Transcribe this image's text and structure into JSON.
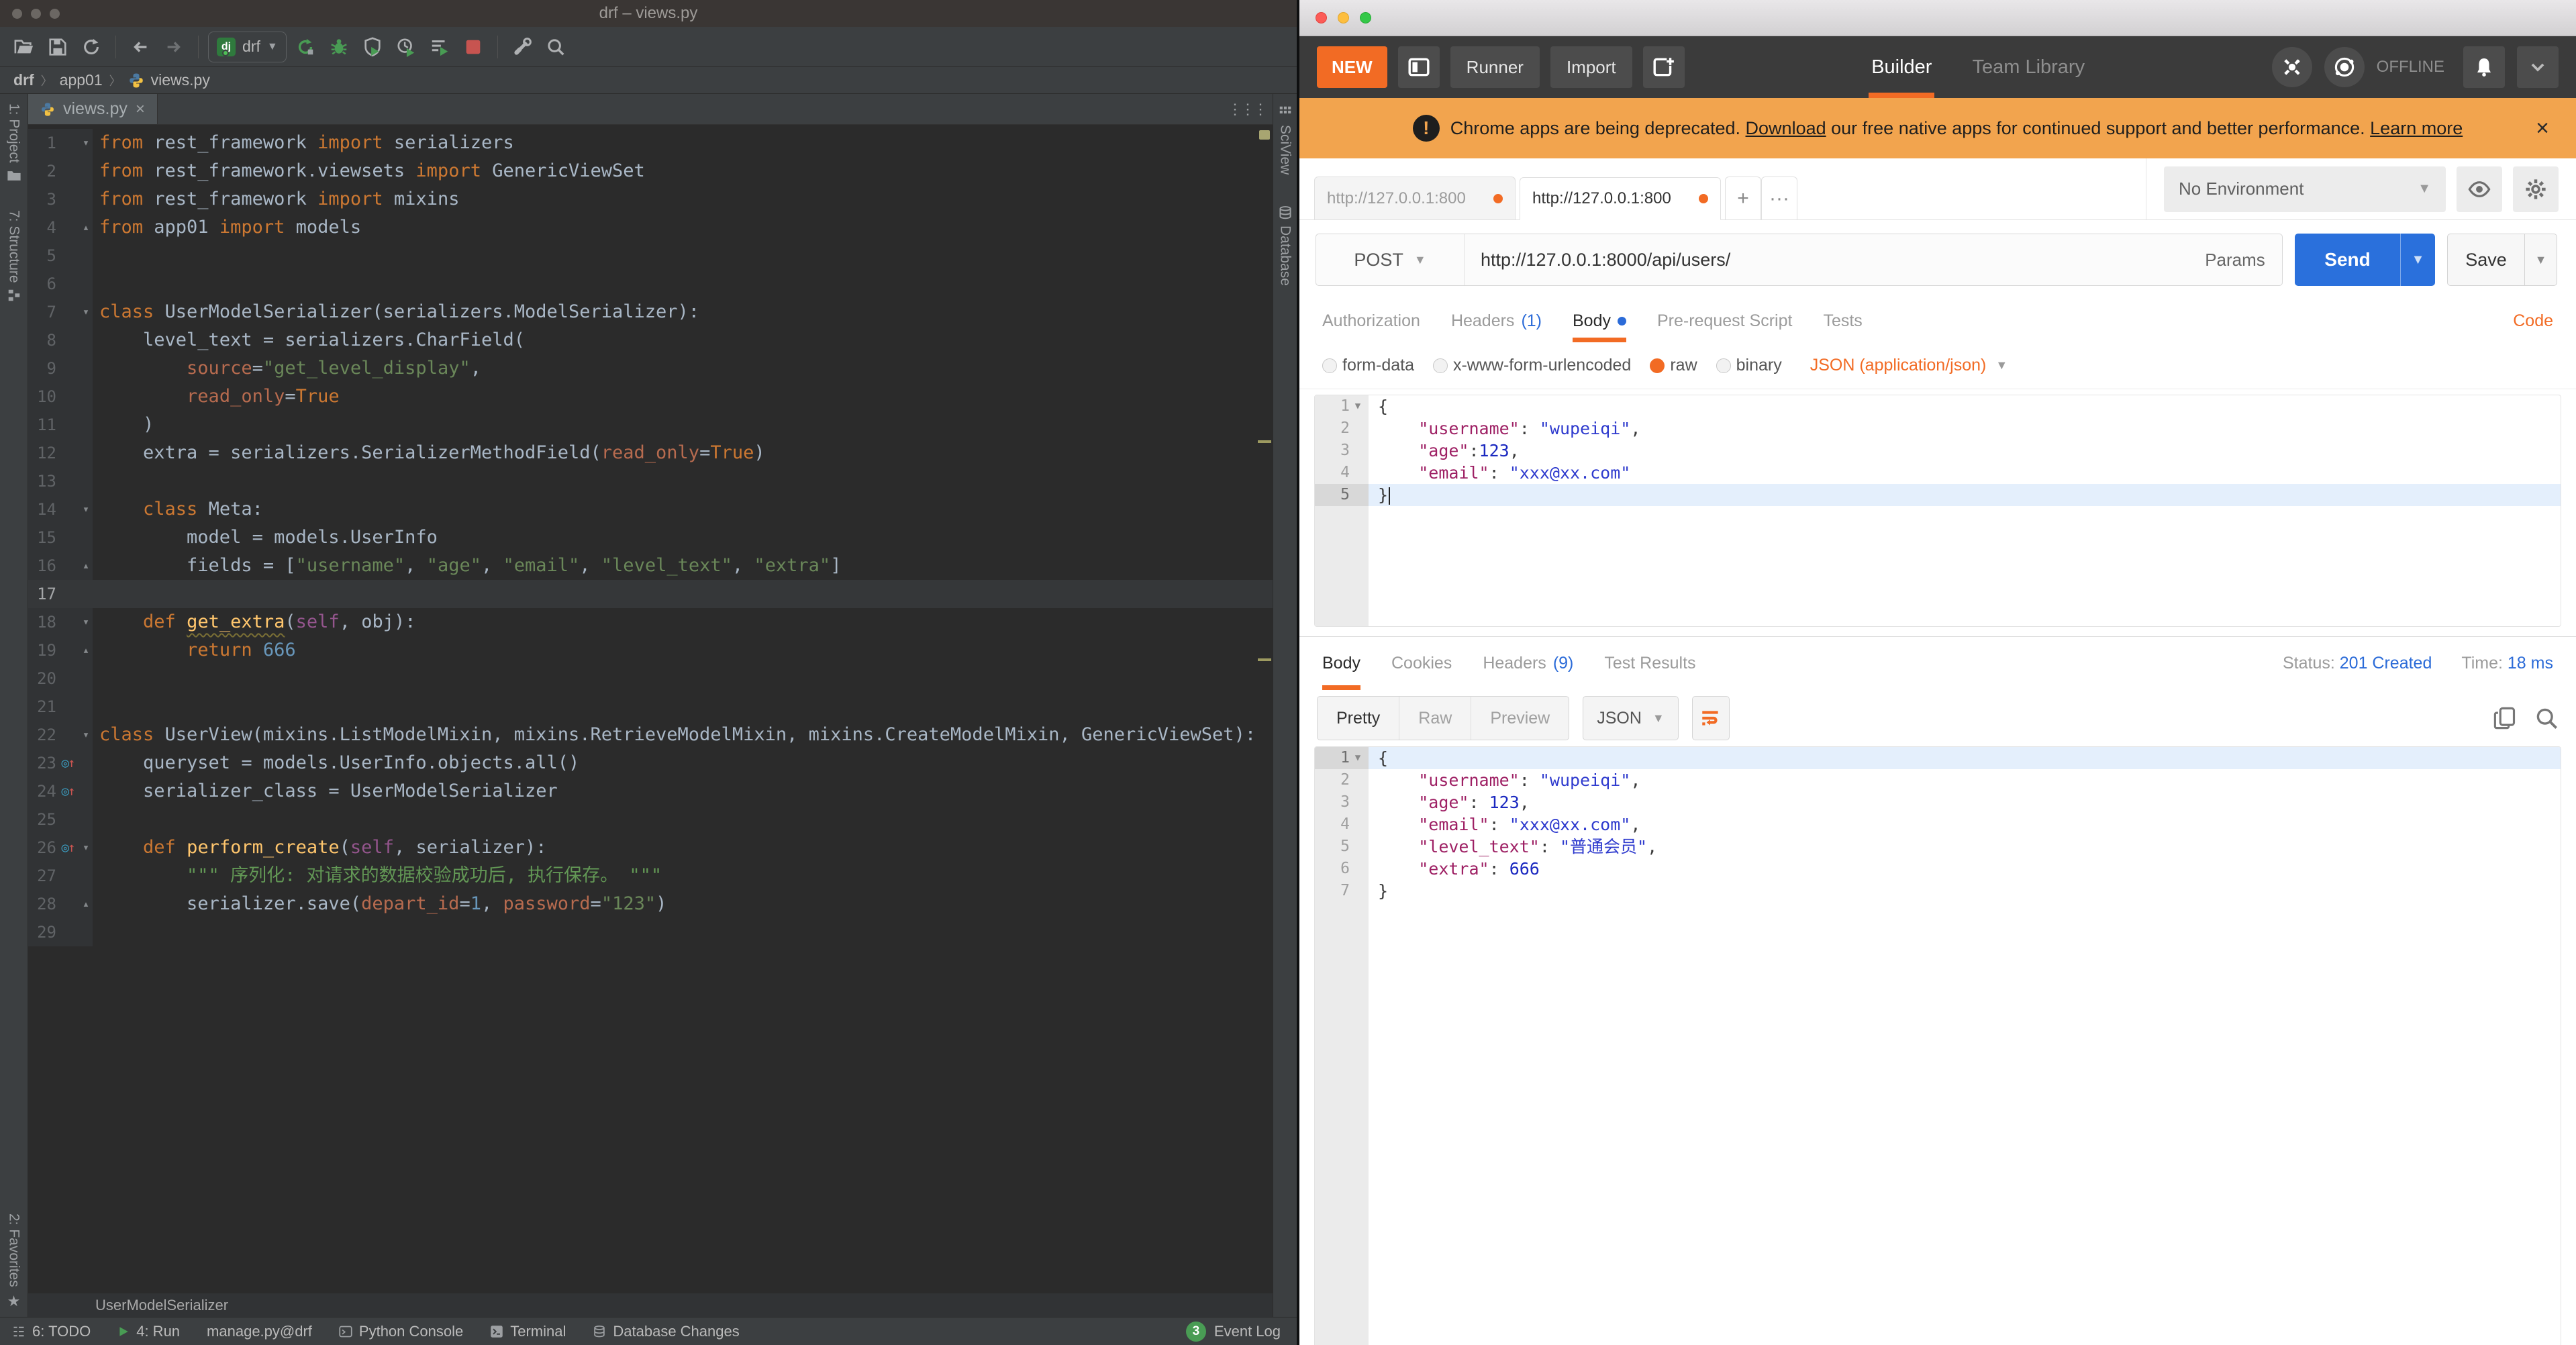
{
  "pycharm": {
    "title": "drf – views.py",
    "toolbar": {
      "run_config": "drf"
    },
    "breadcrumbs": [
      "drf",
      "app01",
      "views.py"
    ],
    "tab": "views.py",
    "stripes": {
      "left": [
        "1: Project",
        "7: Structure"
      ],
      "left_bottom": "2: Favorites",
      "right": [
        "SciView",
        "Database"
      ]
    },
    "bottom_breadcrumb": "UserModelSerializer",
    "status": {
      "items": [
        "6: TODO",
        "4: Run",
        "manage.py@drf",
        "Python Console",
        "Terminal",
        "Database Changes"
      ],
      "event_log": "Event Log",
      "event_badge": "3"
    },
    "editor": {
      "lines": [
        {
          "n": 1,
          "fold": "o",
          "t": [
            [
              "kw",
              "from"
            ],
            [
              "tx",
              " rest_framework "
            ],
            [
              "kw",
              "import"
            ],
            [
              "tx",
              " serializers"
            ]
          ]
        },
        {
          "n": 2,
          "t": [
            [
              "kw",
              "from"
            ],
            [
              "tx",
              " rest_framework.viewsets "
            ],
            [
              "kw",
              "import"
            ],
            [
              "tx",
              " GenericViewSet"
            ]
          ]
        },
        {
          "n": 3,
          "t": [
            [
              "kw",
              "from"
            ],
            [
              "tx",
              " rest_framework "
            ],
            [
              "kw",
              "import"
            ],
            [
              "tx",
              " mixins"
            ]
          ]
        },
        {
          "n": 4,
          "fold": "c",
          "t": [
            [
              "kw",
              "from"
            ],
            [
              "tx",
              " app01 "
            ],
            [
              "kw",
              "import"
            ],
            [
              "tx",
              " models"
            ]
          ]
        },
        {
          "n": 5,
          "t": []
        },
        {
          "n": 6,
          "t": []
        },
        {
          "n": 7,
          "fold": "o",
          "t": [
            [
              "kw",
              "class"
            ],
            [
              "tx",
              " UserModelSerializer(serializers.ModelSerializer):"
            ]
          ]
        },
        {
          "n": 8,
          "t": [
            [
              "tx",
              "    level_text = serializers.CharField("
            ]
          ]
        },
        {
          "n": 9,
          "t": [
            [
              "tx",
              "        "
            ],
            [
              "ar",
              "source"
            ],
            [
              "tx",
              "="
            ],
            [
              "st",
              "\"get_level_display\""
            ],
            [
              "tx",
              ","
            ]
          ]
        },
        {
          "n": 10,
          "t": [
            [
              "tx",
              "        "
            ],
            [
              "ar",
              "read_only"
            ],
            [
              "tx",
              "="
            ],
            [
              "kw",
              "True"
            ]
          ]
        },
        {
          "n": 11,
          "t": [
            [
              "tx",
              "    )"
            ]
          ]
        },
        {
          "n": 12,
          "t": [
            [
              "tx",
              "    extra = serializers.SerializerMethodField("
            ],
            [
              "ar",
              "read_only"
            ],
            [
              "tx",
              "="
            ],
            [
              "kw",
              "True"
            ],
            [
              "tx",
              ")"
            ]
          ]
        },
        {
          "n": 13,
          "t": []
        },
        {
          "n": 14,
          "fold": "o",
          "t": [
            [
              "tx",
              "    "
            ],
            [
              "kw",
              "class"
            ],
            [
              "tx",
              " Meta:"
            ]
          ]
        },
        {
          "n": 15,
          "t": [
            [
              "tx",
              "        model = models.UserInfo"
            ]
          ]
        },
        {
          "n": 16,
          "fold": "c",
          "t": [
            [
              "tx",
              "        fields = ["
            ],
            [
              "st",
              "\"username\""
            ],
            [
              "tx",
              ", "
            ],
            [
              "st",
              "\"age\""
            ],
            [
              "tx",
              ", "
            ],
            [
              "st",
              "\"email\""
            ],
            [
              "tx",
              ", "
            ],
            [
              "st",
              "\"level_text\""
            ],
            [
              "tx",
              ", "
            ],
            [
              "st",
              "\"extra\""
            ],
            [
              "tx",
              "]"
            ]
          ]
        },
        {
          "n": 17,
          "hl": true,
          "t": []
        },
        {
          "n": 18,
          "fold": "o",
          "t": [
            [
              "tx",
              "    "
            ],
            [
              "kw",
              "def"
            ],
            [
              "tx",
              " "
            ],
            [
              "fw",
              "get_extra"
            ],
            [
              "tx",
              "("
            ],
            [
              "sf",
              "self"
            ],
            [
              "tx",
              ", obj):"
            ]
          ]
        },
        {
          "n": 19,
          "fold": "c",
          "t": [
            [
              "tx",
              "        "
            ],
            [
              "kw",
              "return"
            ],
            [
              "tx",
              " "
            ],
            [
              "nm",
              "666"
            ]
          ]
        },
        {
          "n": 20,
          "t": []
        },
        {
          "n": 21,
          "t": []
        },
        {
          "n": 22,
          "fold": "o",
          "t": [
            [
              "kw",
              "class"
            ],
            [
              "tx",
              " UserView(mixins.ListModelMixin, mixins.RetrieveModelMixin, mixins.CreateModelMixin, GenericViewSet):"
            ]
          ]
        },
        {
          "n": 23,
          "ovr": true,
          "t": [
            [
              "tx",
              "    queryset = models.UserInfo.objects.all()"
            ]
          ]
        },
        {
          "n": 24,
          "ovr": true,
          "t": [
            [
              "tx",
              "    serializer_class = UserModelSerializer"
            ]
          ]
        },
        {
          "n": 25,
          "t": []
        },
        {
          "n": 26,
          "ovr": true,
          "fold": "o",
          "t": [
            [
              "tx",
              "    "
            ],
            [
              "kw",
              "def"
            ],
            [
              "tx",
              " "
            ],
            [
              "fn",
              "perform_create"
            ],
            [
              "tx",
              "("
            ],
            [
              "sf",
              "self"
            ],
            [
              "tx",
              ", serializer):"
            ]
          ]
        },
        {
          "n": 27,
          "t": [
            [
              "dc",
              "        \"\"\" 序列化: 对请求的数据校验成功后, 执行保存。 \"\"\""
            ]
          ]
        },
        {
          "n": 28,
          "fold": "c",
          "t": [
            [
              "tx",
              "        serializer.save("
            ],
            [
              "ar",
              "depart_id"
            ],
            [
              "tx",
              "="
            ],
            [
              "nm",
              "1"
            ],
            [
              "tx",
              ", "
            ],
            [
              "ar",
              "password"
            ],
            [
              "tx",
              "="
            ],
            [
              "st",
              "\"123\""
            ],
            [
              "tx",
              ")"
            ]
          ]
        },
        {
          "n": 29,
          "t": []
        }
      ]
    }
  },
  "postman": {
    "header": {
      "new_label": "NEW",
      "runner_label": "Runner",
      "import_label": "Import",
      "builder_tab": "Builder",
      "team_library_tab": "Team Library",
      "offline_label": "OFFLINE"
    },
    "banner": {
      "prefix": "Chrome apps are being deprecated.",
      "link_download": "Download",
      "middle": "our free native apps for continued support and better performance.",
      "link_learn_more": "Learn more",
      "close": "×"
    },
    "tabs": {
      "tab1": "http://127.0.0.1:800",
      "tab2": "http://127.0.0.1:800",
      "new_tab": "+",
      "more": "···"
    },
    "environment": {
      "selected": "No Environment"
    },
    "request": {
      "method": "POST",
      "url": "http://127.0.0.1:8000/api/users/",
      "params_label": "Params",
      "send_label": "Send",
      "save_label": "Save",
      "tabs": {
        "authorization": "Authorization",
        "headers": "Headers",
        "headers_count": "(1)",
        "body": "Body",
        "prerequest": "Pre-request Script",
        "tests": "Tests",
        "code_link": "Code"
      },
      "modes": [
        "form-data",
        "x-www-form-urlencoded",
        "raw",
        "binary"
      ],
      "selected_mode": "raw",
      "content_type": "JSON (application/json)",
      "body_lines": [
        {
          "n": 1,
          "fold": true,
          "t": [
            [
              "pu",
              "{"
            ]
          ]
        },
        {
          "n": 2,
          "t": [
            [
              "pu",
              "    "
            ],
            [
              "ky",
              "\"username\""
            ],
            [
              "pu",
              ": "
            ],
            [
              "st",
              "\"wupeiqi\""
            ],
            [
              "pu",
              ","
            ]
          ]
        },
        {
          "n": 3,
          "t": [
            [
              "pu",
              "    "
            ],
            [
              "ky",
              "\"age\""
            ],
            [
              "pu",
              ":"
            ],
            [
              "nm",
              "123"
            ],
            [
              "pu",
              ","
            ]
          ]
        },
        {
          "n": 4,
          "t": [
            [
              "pu",
              "    "
            ],
            [
              "ky",
              "\"email\""
            ],
            [
              "pu",
              ": "
            ],
            [
              "st",
              "\"xxx@xx.com\""
            ]
          ]
        },
        {
          "n": 5,
          "hl": true,
          "caret": true,
          "t": [
            [
              "pu",
              "}"
            ]
          ]
        }
      ]
    },
    "response": {
      "tabs": {
        "body": "Body",
        "cookies": "Cookies",
        "headers": "Headers",
        "headers_count": "(9)",
        "tests": "Test Results"
      },
      "status_label": "Status:",
      "status_value": "201 Created",
      "time_label": "Time:",
      "time_value": "18 ms",
      "views": [
        "Pretty",
        "Raw",
        "Preview"
      ],
      "format": "JSON",
      "body_lines": [
        {
          "n": 1,
          "hl": true,
          "fold": true,
          "t": [
            [
              "pu",
              "{"
            ]
          ]
        },
        {
          "n": 2,
          "t": [
            [
              "pu",
              "    "
            ],
            [
              "ky",
              "\"username\""
            ],
            [
              "pu",
              ": "
            ],
            [
              "st",
              "\"wupeiqi\""
            ],
            [
              "pu",
              ","
            ]
          ]
        },
        {
          "n": 3,
          "t": [
            [
              "pu",
              "    "
            ],
            [
              "ky",
              "\"age\""
            ],
            [
              "pu",
              ": "
            ],
            [
              "nm",
              "123"
            ],
            [
              "pu",
              ","
            ]
          ]
        },
        {
          "n": 4,
          "t": [
            [
              "pu",
              "    "
            ],
            [
              "ky",
              "\"email\""
            ],
            [
              "pu",
              ": "
            ],
            [
              "st",
              "\"xxx@xx.com\""
            ],
            [
              "pu",
              ","
            ]
          ]
        },
        {
          "n": 5,
          "t": [
            [
              "pu",
              "    "
            ],
            [
              "ky",
              "\"level_text\""
            ],
            [
              "pu",
              ": "
            ],
            [
              "st",
              "\"普通会员\""
            ],
            [
              "pu",
              ","
            ]
          ]
        },
        {
          "n": 6,
          "t": [
            [
              "pu",
              "    "
            ],
            [
              "ky",
              "\"extra\""
            ],
            [
              "pu",
              ": "
            ],
            [
              "nm",
              "666"
            ]
          ]
        },
        {
          "n": 7,
          "t": [
            [
              "pu",
              "}"
            ]
          ]
        }
      ]
    }
  }
}
